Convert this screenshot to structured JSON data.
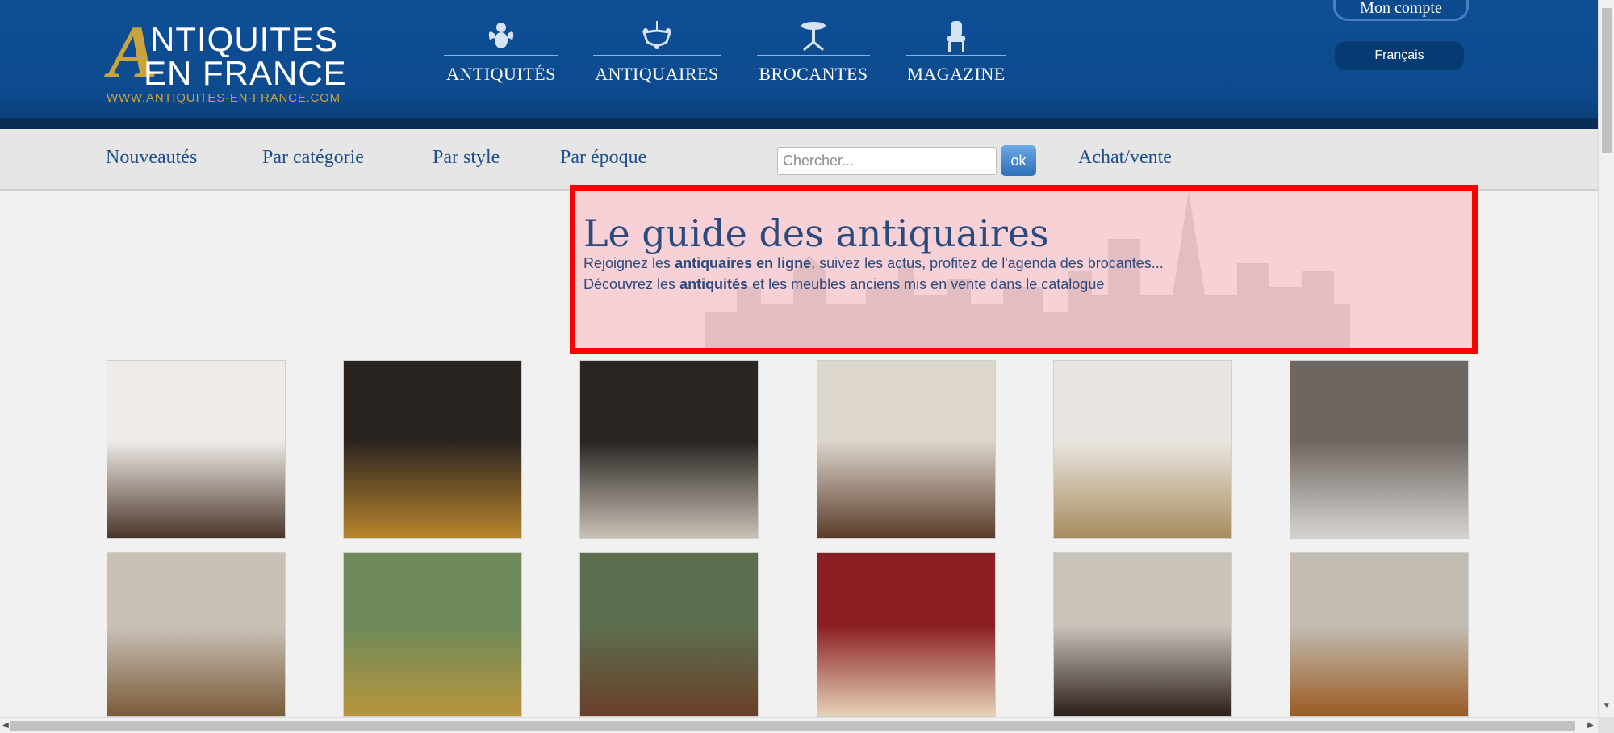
{
  "header": {
    "logo": {
      "big_letter": "A",
      "line1": "NTIQUITES",
      "line2": "EN FRANCE",
      "url": "WWW.ANTIQUITES-EN-FRANCE.COM"
    },
    "nav": [
      {
        "label": "ANTIQUITÉS",
        "icon": "cherub-icon"
      },
      {
        "label": "ANTIQUAIRES",
        "icon": "chandelier-icon"
      },
      {
        "label": "BROCANTES",
        "icon": "pedestal-table-icon"
      },
      {
        "label": "MAGAZINE",
        "icon": "armchair-icon"
      }
    ],
    "account_label": "Mon compte",
    "language_label": "Français"
  },
  "subnav": {
    "links": [
      "Nouveautés",
      "Par catégorie",
      "Par style",
      "Par époque"
    ],
    "search_placeholder": "Chercher...",
    "search_button": "ok",
    "buy_sell": "Achat/vente"
  },
  "guide": {
    "title": "Le guide des antiquaires",
    "line1": {
      "before": "Rejoignez les ",
      "bold": "antiquaires en ligne",
      "after": ", suivez les actus, profitez de l'agenda des brocantes..."
    },
    "line2": {
      "before": "Découvrez les ",
      "bold": "antiquités",
      "after": " et les meubles anciens mis en vente dans le catalogue"
    }
  },
  "products": [
    {
      "name": "lamp",
      "colors": [
        "#efece8",
        "#4a3528"
      ]
    },
    {
      "name": "gilt-bust",
      "colors": [
        "#2a2420",
        "#b8862e"
      ]
    },
    {
      "name": "glass-vitrine",
      "colors": [
        "#2b2522",
        "#c8c2b7"
      ]
    },
    {
      "name": "wall-consoles",
      "colors": [
        "#dcd6cd",
        "#5a3b29"
      ]
    },
    {
      "name": "framed-painting",
      "colors": [
        "#e9e6e1",
        "#a68c5e"
      ]
    },
    {
      "name": "crystal-glasses",
      "colors": [
        "#6e6661",
        "#d7d4d0"
      ]
    },
    {
      "name": "folding-screen",
      "colors": [
        "#c9c1b6",
        "#7a5b3a"
      ]
    },
    {
      "name": "portrait-painting",
      "colors": [
        "#6e8a5a",
        "#b8953d"
      ]
    },
    {
      "name": "wall-mirrors",
      "colors": [
        "#5d6e4e",
        "#6a3f2b"
      ]
    },
    {
      "name": "rug",
      "colors": [
        "#8c1f24",
        "#e5d3b6"
      ]
    },
    {
      "name": "games-table",
      "colors": [
        "#c8c2b9",
        "#2b1f19"
      ]
    },
    {
      "name": "wardrobe",
      "colors": [
        "#c2bcb2",
        "#9a5b22"
      ]
    }
  ]
}
